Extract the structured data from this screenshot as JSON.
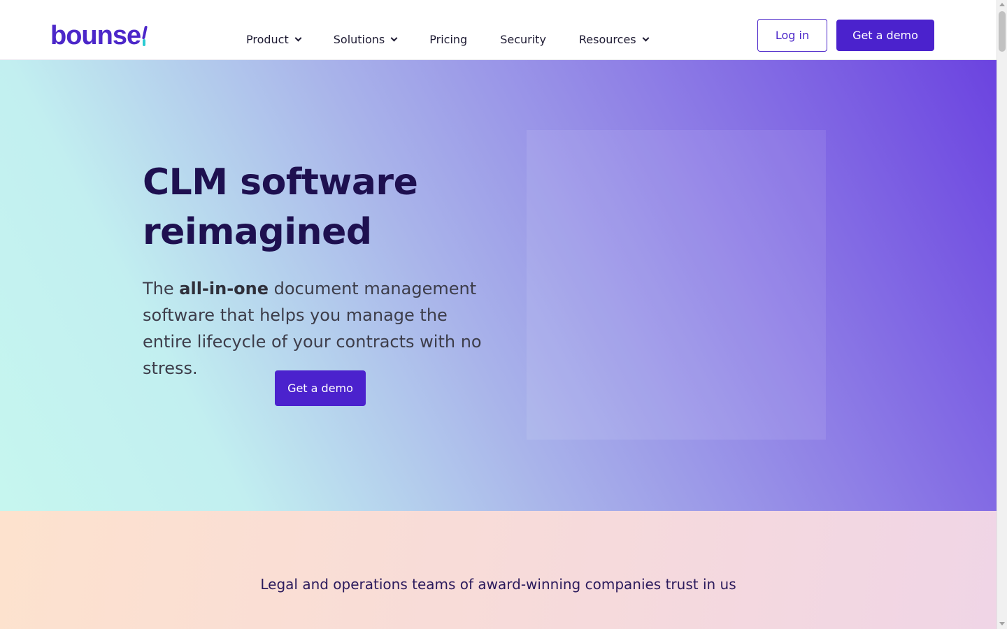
{
  "header": {
    "logo_text": "bounse",
    "logo_colors": {
      "primary": "#4c27c9",
      "accent": "#2bcbd2"
    },
    "nav": [
      {
        "label": "Product",
        "has_dropdown": true
      },
      {
        "label": "Solutions",
        "has_dropdown": true
      },
      {
        "label": "Pricing",
        "has_dropdown": false
      },
      {
        "label": "Security",
        "has_dropdown": false
      },
      {
        "label": "Resources",
        "has_dropdown": true
      }
    ],
    "login_label": "Log in",
    "demo_label": "Get a demo"
  },
  "hero": {
    "title_line1": "CLM software",
    "title_line2": "reimagined",
    "subtitle_prefix": "The ",
    "subtitle_bold": "all-in-one",
    "subtitle_rest": " document management software that helps you manage the entire lifecycle of your contracts with no stress.",
    "cta_label": "Get a demo"
  },
  "trust": {
    "text": "Legal and operations teams of award-winning companies trust in us"
  },
  "colors": {
    "brand": "#4b22cd",
    "title": "#1e1050"
  }
}
